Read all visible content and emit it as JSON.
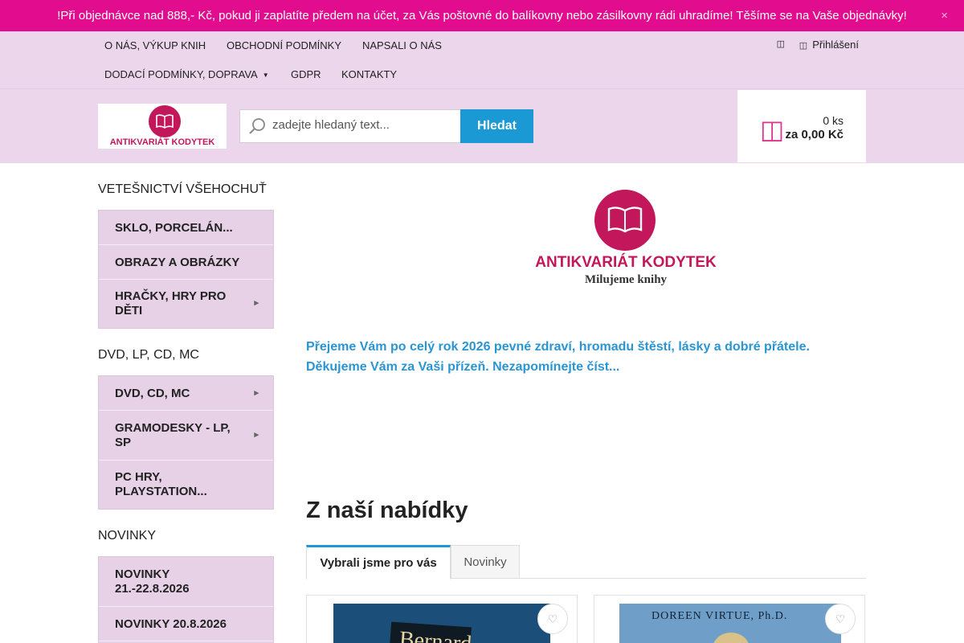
{
  "infobar": {
    "message": "!Při objednávce nad 888,- Kč, pokud ji zaplatíte předem na účet, za Vás poštovné do balíkovny nebo zásilkovny rádi uhradíme! Těšíme se na Vaše objednávky!",
    "close_icon": "×"
  },
  "nav": {
    "row1": [
      "O nás, výkup knih",
      "Obchodní podmínky",
      "Napsali o nás"
    ],
    "row2": [
      "Dodací podmínky, doprava",
      "GDPR",
      "Kontakty"
    ],
    "login_label": "Přihlášení"
  },
  "header": {
    "logo_text": "ANTIKVARIÁT KODYTEK",
    "search_placeholder": "zadejte hledaný text...",
    "search_button": "Hledat",
    "cart_qty": "0 ks",
    "cart_total": "za 0,00 Kč"
  },
  "sidebar": {
    "sections": [
      {
        "heading": "Vetešnictví Všehochuť",
        "items": [
          {
            "label": "Sklo, porcelán...",
            "has_arrow": false
          },
          {
            "label": "Obrazy a obrázky",
            "has_arrow": false
          },
          {
            "label": "Hračky, hry pro děti",
            "has_arrow": true
          }
        ]
      },
      {
        "heading": "DVD, LP, CD, MC",
        "items": [
          {
            "label": "DVD, CD, MC",
            "has_arrow": true
          },
          {
            "label": "Gramodesky - LP, SP",
            "has_arrow": true
          },
          {
            "label": "PC hry, playstation...",
            "has_arrow": false
          }
        ]
      },
      {
        "heading": "Novinky",
        "items": [
          {
            "label": "Novinky 21.-22.8.2026",
            "has_arrow": false
          },
          {
            "label": "Novinky 20.8.2026",
            "has_arrow": false
          }
        ]
      }
    ]
  },
  "main": {
    "hero_name": "ANTIKVARIÁT KODYTEK",
    "hero_tagline": "Milujeme knihy",
    "greeting_line1": "Přejeme Vám po celý rok 2026 pevné zdraví, hromadu štěstí, lásky a dobré přátele.",
    "greeting_line2": "Děkujeme Vám za Vaši přízeň. Nezapomínejte číst...",
    "section_title": "Z naší nabídky",
    "tabs": [
      "Vybrali jsme pro vás",
      "Novinky"
    ],
    "products": [
      {
        "cover_text": "Bernard",
        "cover_color": "#1b4f7a"
      },
      {
        "cover_text": "DOREEN VIRTUE, Ph.D.",
        "cover_color": "#6f9fc9"
      }
    ]
  },
  "colors": {
    "accent": "#e20d8e",
    "link_blue": "#2a95d3",
    "button_blue": "#1a99d5",
    "brand": "#c2185b",
    "nav_bg": "#ecd6ec"
  }
}
